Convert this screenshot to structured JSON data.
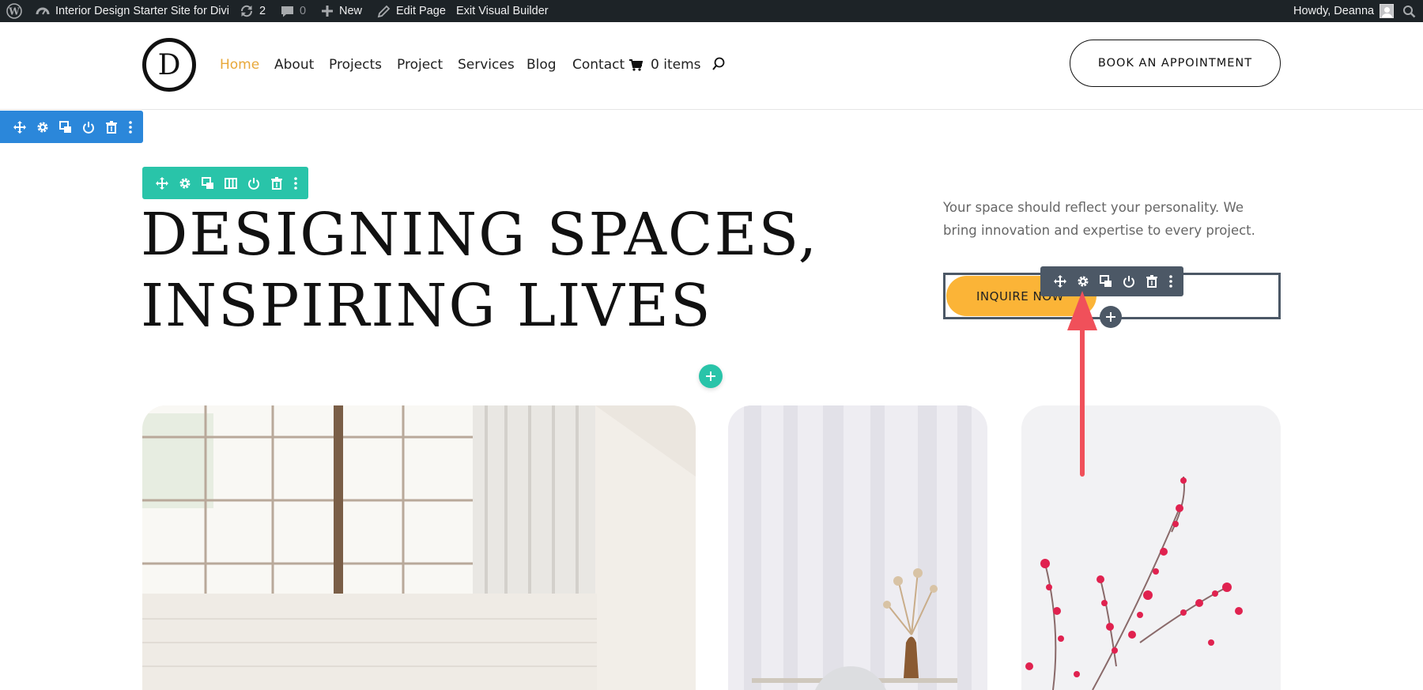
{
  "adminbar": {
    "site_name": "Interior Design Starter Site for Divi",
    "updates_count": "2",
    "comments_count": "0",
    "new_label": "New",
    "edit_page_label": "Edit Page",
    "exit_builder_label": "Exit Visual Builder",
    "howdy_label": "Howdy, Deanna"
  },
  "header": {
    "logo_letter": "D",
    "nav": {
      "home": "Home",
      "about": "About",
      "projects": "Projects",
      "project": "Project",
      "services": "Services",
      "blog": "Blog",
      "contact": "Contact"
    },
    "cart_label": "0 items",
    "book_button": "BOOK AN APPOINTMENT"
  },
  "hero": {
    "title_line1": "DESIGNING SPACES,",
    "title_line2": "INSPIRING LIVES",
    "text": "Your space should reflect your personality. We bring innovation and expertise to every project.",
    "button_label": "INQUIRE NOW"
  },
  "colors": {
    "admin_bar": "#1d2327",
    "section_toolbar": "#2b87da",
    "row_toolbar": "#29c4a9",
    "module_toolbar": "#4c5866",
    "accent_button": "#fbb437",
    "active_nav": "#e8a83a",
    "annotation_arrow": "#f0505a"
  },
  "icons": {
    "toolbar": [
      "move-icon",
      "gear-icon",
      "duplicate-icon",
      "columns-icon",
      "power-icon",
      "trash-icon",
      "more-icon"
    ]
  }
}
